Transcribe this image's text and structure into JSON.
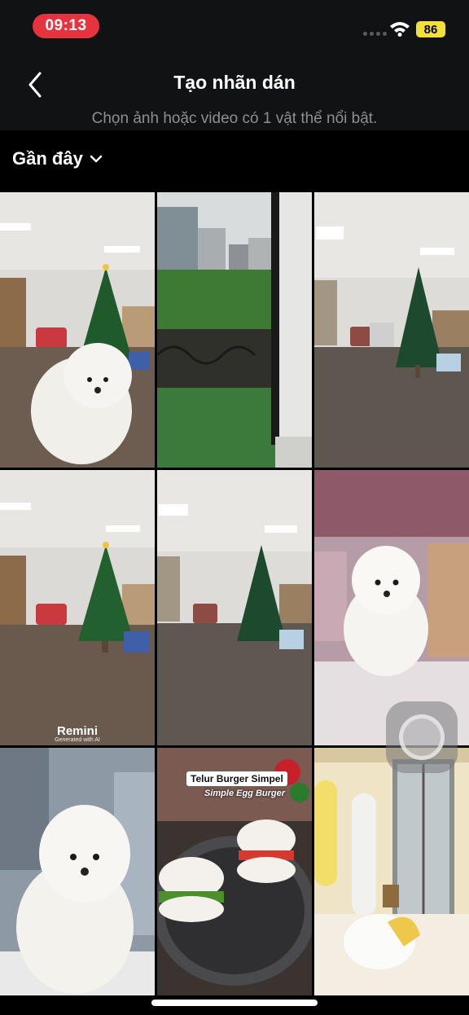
{
  "status_bar": {
    "time": "09:13",
    "battery": "86"
  },
  "header": {
    "title": "Tạo nhãn dán",
    "subtitle": "Chọn ảnh hoặc video có 1 vật thể nổi bật."
  },
  "album": {
    "label": "Gần đây"
  },
  "gallery": [
    {
      "subject": "puppy in office with christmas tree"
    },
    {
      "subject": "balcony city view"
    },
    {
      "subject": "office with christmas tree"
    },
    {
      "subject": "office with decorated christmas tree",
      "watermark": "Remini",
      "watermark_sub": "Generated with AI"
    },
    {
      "subject": "office with christmas tree"
    },
    {
      "subject": "white puppy in shop"
    },
    {
      "subject": "white puppy sitting"
    },
    {
      "subject": "egg burgers",
      "caption_title": "Telur Burger Simpel",
      "caption_subtitle": "Simple Egg Burger"
    },
    {
      "subject": "room with window and lamp"
    }
  ],
  "colors": {
    "status_time_bg": "#e5343f",
    "battery_bg": "#f3e03a",
    "header_bg": "#111214"
  },
  "icons": [
    "back-arrow-icon",
    "chevron-down-icon",
    "wifi-icon",
    "assistive-touch-icon"
  ]
}
